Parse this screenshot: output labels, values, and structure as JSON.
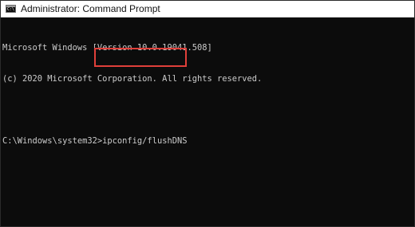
{
  "window": {
    "title": "Administrator: Command Prompt",
    "icon_label": "C:\\"
  },
  "console": {
    "lines": [
      "Microsoft Windows [Version 10.0.19041.508]",
      "(c) 2020 Microsoft Corporation. All rights reserved."
    ],
    "prompt": "C:\\Windows\\system32>",
    "command": "ipconfig/flushDNS"
  },
  "colors": {
    "background": "#0c0c0c",
    "text": "#cccccc",
    "highlight": "#e0403a"
  }
}
